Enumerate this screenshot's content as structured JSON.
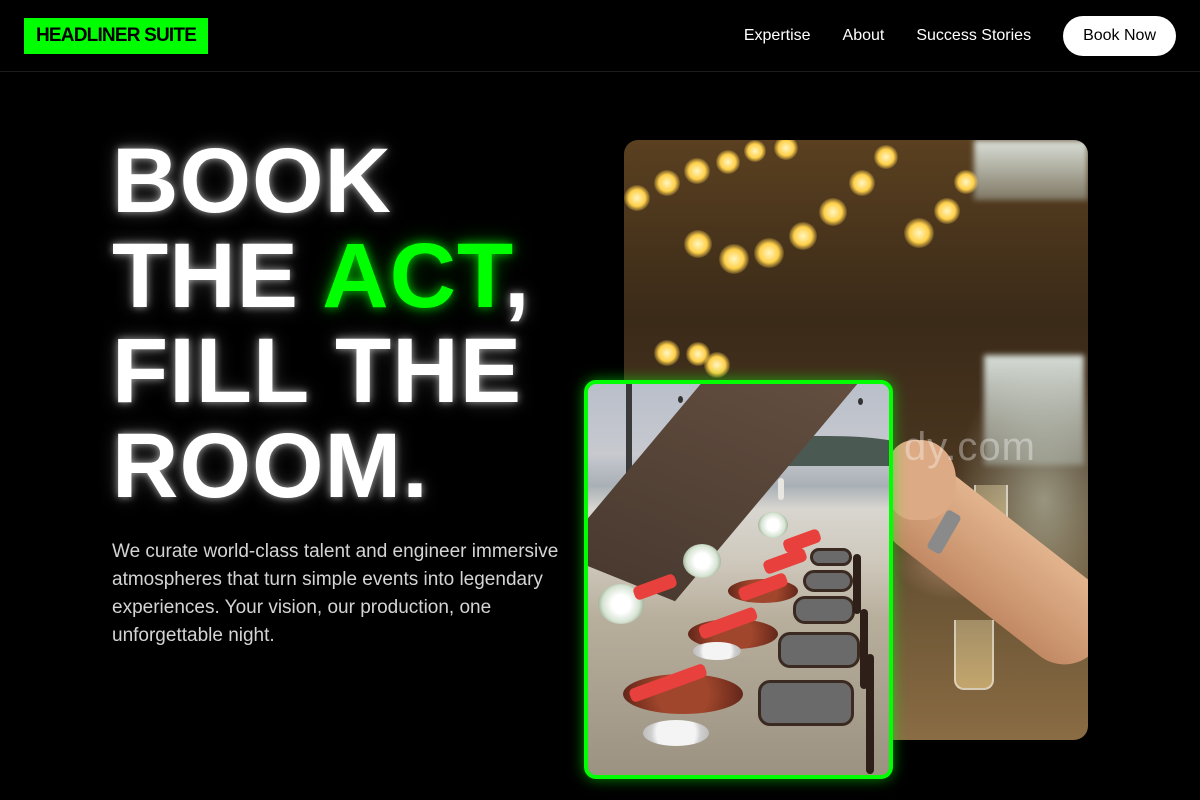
{
  "brand": {
    "logo_text": "HEADLINER SUITE",
    "accent_color": "#00ff00"
  },
  "nav": {
    "links": [
      "Expertise",
      "About",
      "Success Stories"
    ],
    "cta_label": "Book Now"
  },
  "hero": {
    "headline": {
      "line1": "BOOK",
      "line2_pre": "THE ",
      "line2_accent": "ACT",
      "line2_post": ",",
      "line3": "FILL THE",
      "line4": "ROOM."
    },
    "description": "We curate world-class talent and engineer immersive atmospheres that turn simple events into legendary experiences. Your vision, our production, one unforgettable night."
  },
  "images": {
    "back": {
      "subject": "event venue with string lights and guests toasting",
      "watermark": "dy.com"
    },
    "front": {
      "subject": "beach dinner table with red napkins and chairs"
    }
  }
}
